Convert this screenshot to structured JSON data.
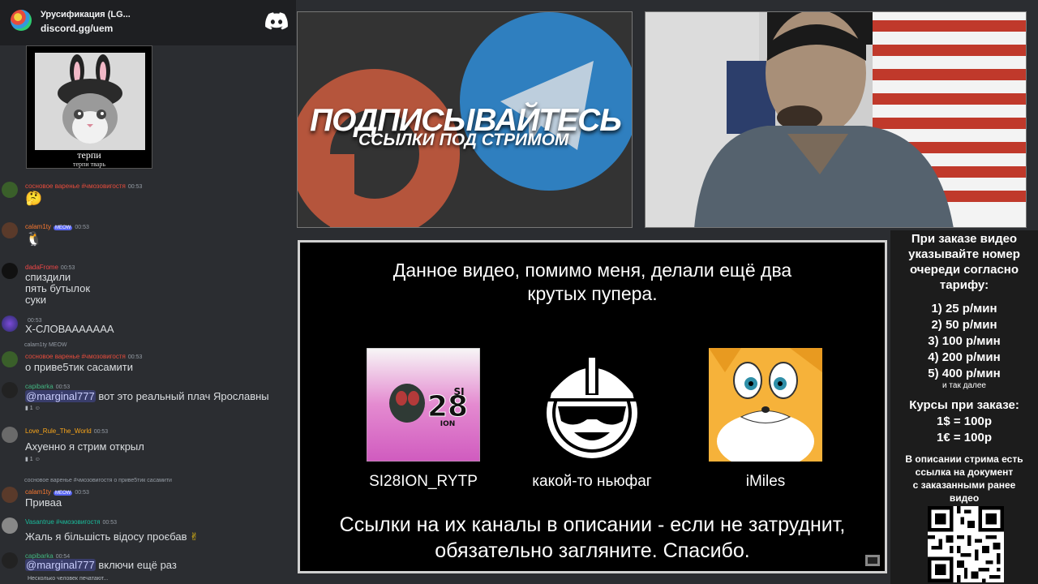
{
  "discord": {
    "server_name": "Урусификация (LG...",
    "invite": "discord.gg/uem",
    "meme_caption": "терпи",
    "meme_subcaption": "терпи тварь",
    "messages": [
      {
        "user": "сосновое варенье #чмозовигостя",
        "time": "00:53",
        "text": "🤔",
        "color": "#e74c3c"
      },
      {
        "user": "calam1ty",
        "badge": "MEOW",
        "time": "00:53",
        "text": "🐧",
        "color": "#f57731"
      },
      {
        "user": "dadaFrome",
        "time": "00:53",
        "lines": [
          "спиздили",
          "пять бутылок",
          "суки"
        ],
        "color": "#f04747"
      },
      {
        "user": "",
        "time": "00:53",
        "text": "Х-СЛОВААААААА",
        "color": "#949ba4"
      },
      {
        "reply": "calam1ty MEOW",
        "user": "сосновое варенье #чмозовигостя",
        "time": "00:53",
        "text": "о приве5тик сасамити",
        "color": "#e74c3c"
      },
      {
        "user": "capibarka",
        "time": "00:53",
        "mention": "@marginal777",
        "text": " вот это реальный плач Ярославны",
        "react": "1",
        "color": "#43b581"
      },
      {
        "user": "Love_Rule_The_World",
        "time": "00:53",
        "text": "Ахуенно я стрим открыл",
        "react": "1",
        "color": "#faa61a"
      },
      {
        "reply": "сосновое варенье #чмозовигостя о приве5тик сасамити",
        "user": "calam1ty",
        "badge": "MEOW",
        "time": "00:53",
        "text": "Приваа",
        "color": "#f57731"
      },
      {
        "user": "Vasantrue #чмозовигостя",
        "time": "00:53",
        "text": "Жаль я більшість відосу проєбав",
        "color": "#1abc9c"
      },
      {
        "user": "capibarka",
        "time": "00:54",
        "mention": "@marginal777",
        "text": " включи ещё раз",
        "color": "#43b581"
      }
    ],
    "typing": "Несколько человек печатают..."
  },
  "promo": {
    "title": "ПОДПИСЫВАЙТЕСЬ",
    "subtitle": "ССЫЛКИ ПОД СТРИМОМ"
  },
  "info": {
    "line1": "Данное видео, помимо меня, делали ещё два",
    "line2": "крутых пупера.",
    "helpers": [
      {
        "name": "SI28ION_RYTP",
        "logo_text": "28",
        "logo_small": "SI",
        "logo_small2": "ION"
      },
      {
        "name": "какой-то ньюфаг"
      },
      {
        "name": "iMiles"
      }
    ],
    "footer1": "Ссылки на их каналы в описании - если не затруднит,",
    "footer2": "обязательно загляните. Спасибо."
  },
  "prices": {
    "header": [
      "При заказе видео",
      "указывайте номер",
      "очереди согласно",
      "тарифу:"
    ],
    "tariffs": [
      "1) 25 р/мин",
      "2) 50 р/мин",
      "3) 100 р/мин",
      "4) 200 р/мин",
      "5) 400 р/мин"
    ],
    "more": "и так далее",
    "rates_title": "Курсы при заказе:",
    "rates": [
      "1$ = 100р",
      "1€ = 100р"
    ],
    "note": [
      "В описании стрима есть",
      "ссылка на документ",
      "с заказанными ранее",
      "видео"
    ]
  }
}
